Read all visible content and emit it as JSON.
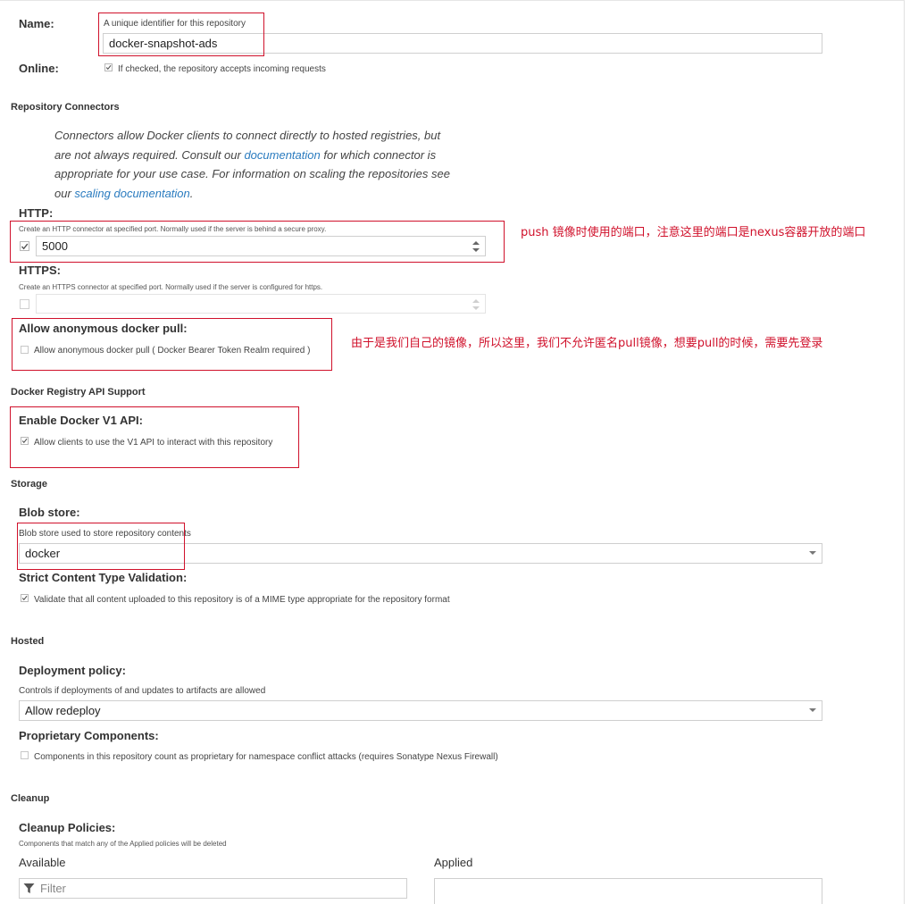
{
  "name": {
    "label": "Name:",
    "help": "A unique identifier for this repository",
    "value": "docker-snapshot-ads"
  },
  "online": {
    "label": "Online:",
    "checked": true,
    "help": "If checked, the repository accepts incoming requests"
  },
  "connectors": {
    "section": "Repository Connectors",
    "intro_1": "Connectors allow Docker clients to connect directly to hosted registries, but are not always required. Consult our ",
    "intro_link_1": "documentation",
    "intro_2": " for which connector is appropriate for your use case. For information on scaling the repositories see our ",
    "intro_link_2": "scaling documentation",
    "intro_3": ".",
    "http": {
      "label": "HTTP:",
      "help": "Create an HTTP connector at specified port. Normally used if the server is behind a secure proxy.",
      "checked": true,
      "value": "5000"
    },
    "https": {
      "label": "HTTPS:",
      "help": "Create an HTTPS connector at specified port. Normally used if the server is configured for https.",
      "checked": false,
      "value": ""
    },
    "anon": {
      "label": "Allow anonymous docker pull:",
      "checked": false,
      "help": "Allow anonymous docker pull ( Docker Bearer Token Realm required )"
    }
  },
  "api": {
    "section": "Docker Registry API Support",
    "label": "Enable Docker V1 API:",
    "checked": true,
    "help": "Allow clients to use the V1 API to interact with this repository"
  },
  "storage": {
    "section": "Storage",
    "blob_label": "Blob store:",
    "blob_help": "Blob store used to store repository contents",
    "blob_value": "docker",
    "strict_label": "Strict Content Type Validation:",
    "strict_checked": true,
    "strict_help": "Validate that all content uploaded to this repository is of a MIME type appropriate for the repository format"
  },
  "hosted": {
    "section": "Hosted",
    "deploy_label": "Deployment policy:",
    "deploy_help": "Controls if deployments of and updates to artifacts are allowed",
    "deploy_value": "Allow redeploy",
    "prop_label": "Proprietary Components:",
    "prop_checked": false,
    "prop_help": "Components in this repository count as proprietary for namespace conflict attacks (requires Sonatype Nexus Firewall)"
  },
  "cleanup": {
    "section": "Cleanup",
    "label": "Cleanup Policies:",
    "help": "Components that match any of the Applied policies will be deleted",
    "available": "Available",
    "applied": "Applied",
    "filter_placeholder": "Filter"
  },
  "annotations": {
    "http_note": "push 镜像时使用的端口，注意这里的端口是nexus容器开放的端口",
    "anon_note": "由于是我们自己的镜像，所以这里，我们不允许匿名pull镜像，想要pull的时候，需要先登录"
  },
  "colors": {
    "annotation": "#d0112b",
    "link": "#2a7bbf"
  }
}
